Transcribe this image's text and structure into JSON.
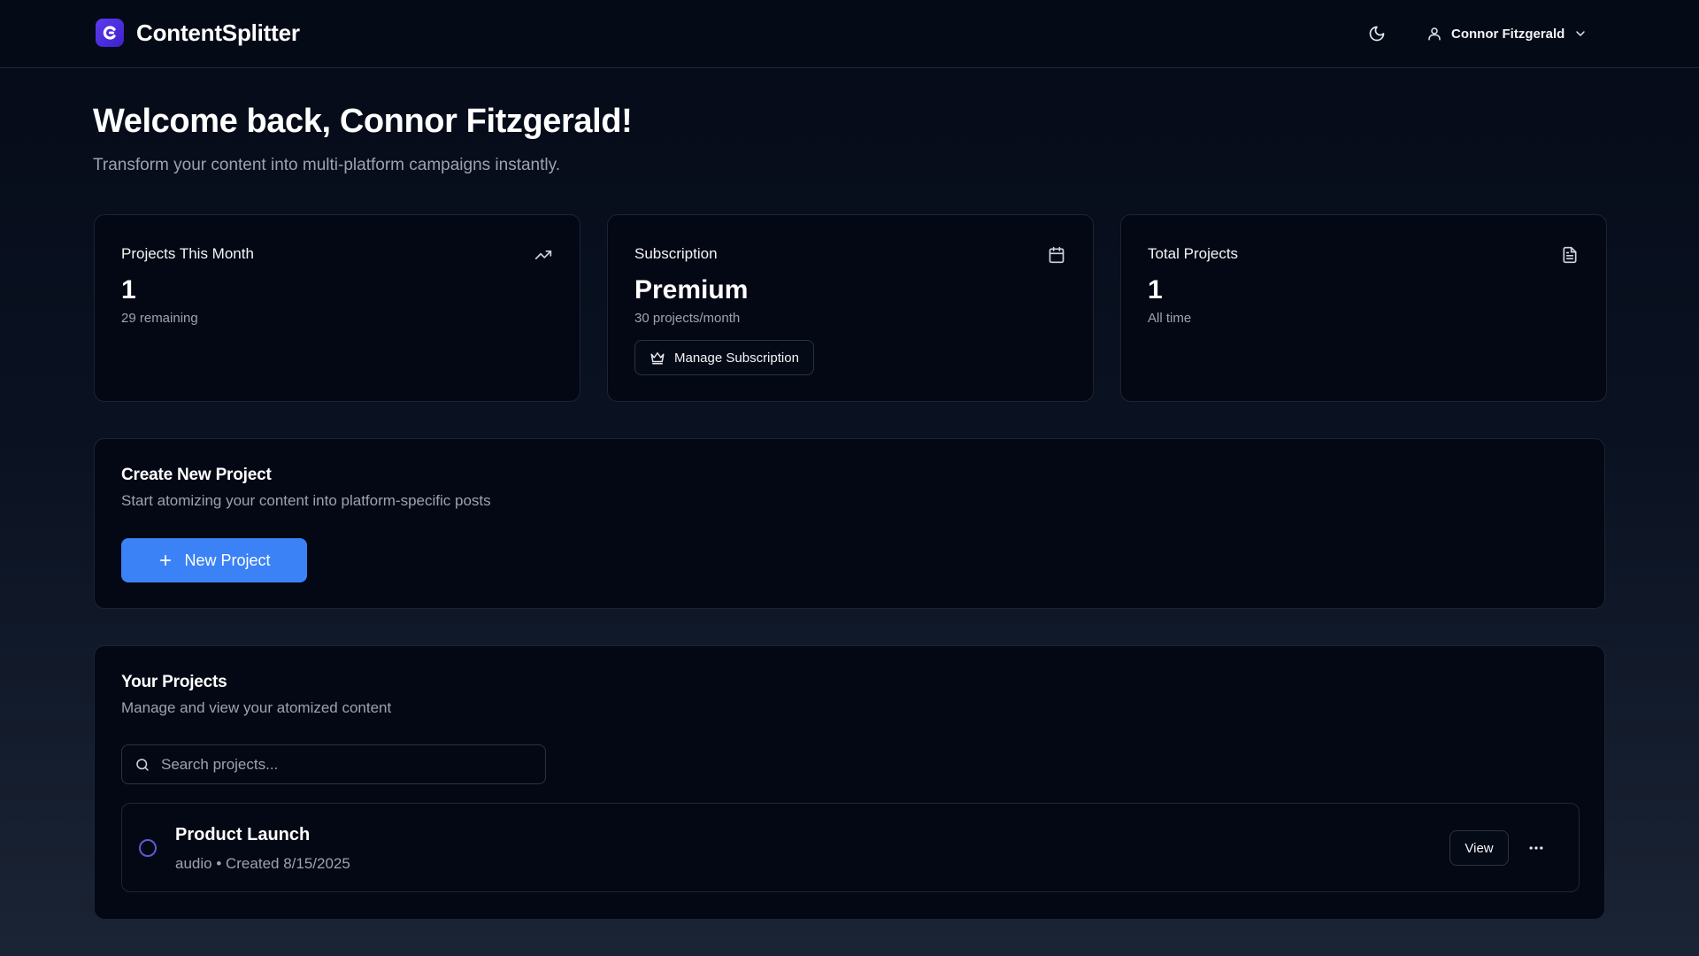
{
  "app": {
    "name": "ContentSplitter"
  },
  "header": {
    "theme_toggle": "moon-icon",
    "user": {
      "name": "Connor Fitzgerald"
    }
  },
  "welcome": {
    "title": "Welcome back, Connor Fitzgerald!",
    "subtitle": "Transform your content into multi-platform campaigns instantly."
  },
  "stats": [
    {
      "title": "Projects This Month",
      "value": "1",
      "sub": "29 remaining",
      "icon": "trending-up-icon"
    },
    {
      "title": "Subscription",
      "value": "Premium",
      "sub": "30 projects/month",
      "icon": "calendar-icon",
      "action_label": "Manage Subscription",
      "action_icon": "crown-icon"
    },
    {
      "title": "Total Projects",
      "value": "1",
      "sub": "All time",
      "icon": "file-text-icon"
    }
  ],
  "create": {
    "title": "Create New Project",
    "subtitle": "Start atomizing your content into platform-specific posts",
    "button_label": "New Project"
  },
  "projects": {
    "title": "Your Projects",
    "subtitle": "Manage and view your atomized content",
    "search_placeholder": "Search projects...",
    "items": [
      {
        "name": "Product Launch",
        "meta": "audio • Created 8/15/2025",
        "view_label": "View"
      }
    ]
  },
  "colors": {
    "accent": "#3b82f6",
    "brand": "#4f2fe0",
    "background": "#050a17",
    "card": "#040814",
    "muted_text": "#9ca3af"
  }
}
